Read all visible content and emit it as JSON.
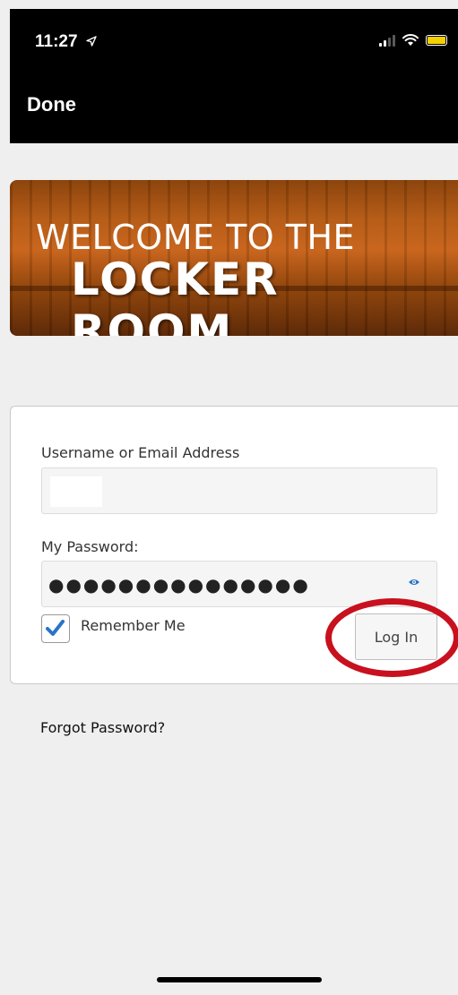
{
  "status_bar": {
    "time": "11:27",
    "icons": [
      "location-arrow-icon",
      "signal-icon",
      "wifi-icon",
      "battery-icon"
    ],
    "battery_color": "#f5d000"
  },
  "nav": {
    "done_label": "Done"
  },
  "banner": {
    "line1": "WELCOME TO THE",
    "line2": "LOCKER ROOM"
  },
  "login": {
    "username_label": "Username or Email Address",
    "password_label": "My Password:",
    "password_mask": "●●●●●●●●●●●●●●●",
    "remember_label": "Remember Me",
    "remember_checked": true,
    "login_button": "Log In"
  },
  "forgot_link": "Forgot Password?",
  "colors": {
    "highlight": "#c8101e",
    "checkbox_check": "#2a74c7"
  }
}
